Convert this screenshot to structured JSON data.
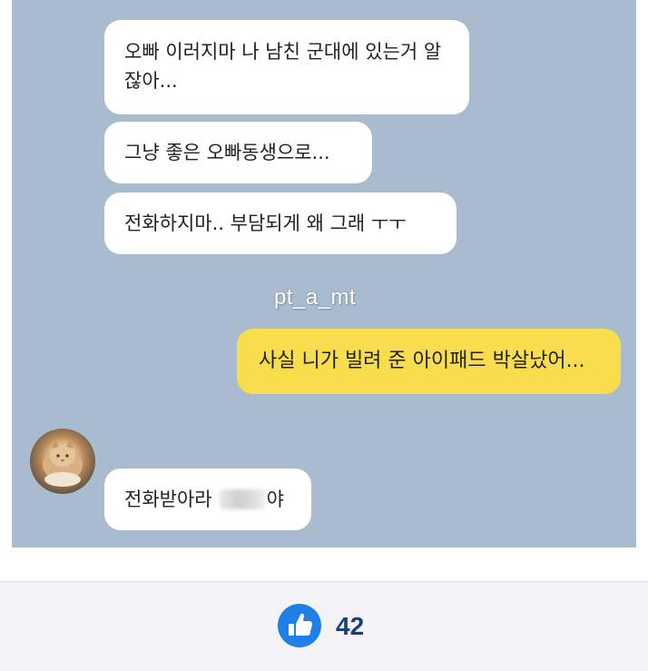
{
  "chat": {
    "messages": [
      {
        "sender": "other",
        "text": "오빠 이러지마 나 남친 군대에 있는거 알잖아..."
      },
      {
        "sender": "other",
        "text": "그냥 좋은 오빠동생으로..."
      },
      {
        "sender": "other",
        "text": "전화하지마.. 부담되게 왜 그래 ㅜㅜ"
      },
      {
        "sender": "me",
        "text": "사실 니가 빌려 준 아이패드 박살났어..."
      },
      {
        "sender": "other",
        "text_before": "전화받아라",
        "text_after": "야"
      }
    ],
    "watermark": "pt_a_mt",
    "avatar_icon": "cat-avatar",
    "colors": {
      "background": "#a9bbcf",
      "my_bubble": "#f8dd4c",
      "other_bubble": "#ffffff"
    }
  },
  "footer": {
    "like_icon": "thumbs-up-icon",
    "like_count": "42",
    "like_color": "#1e7fe6"
  }
}
